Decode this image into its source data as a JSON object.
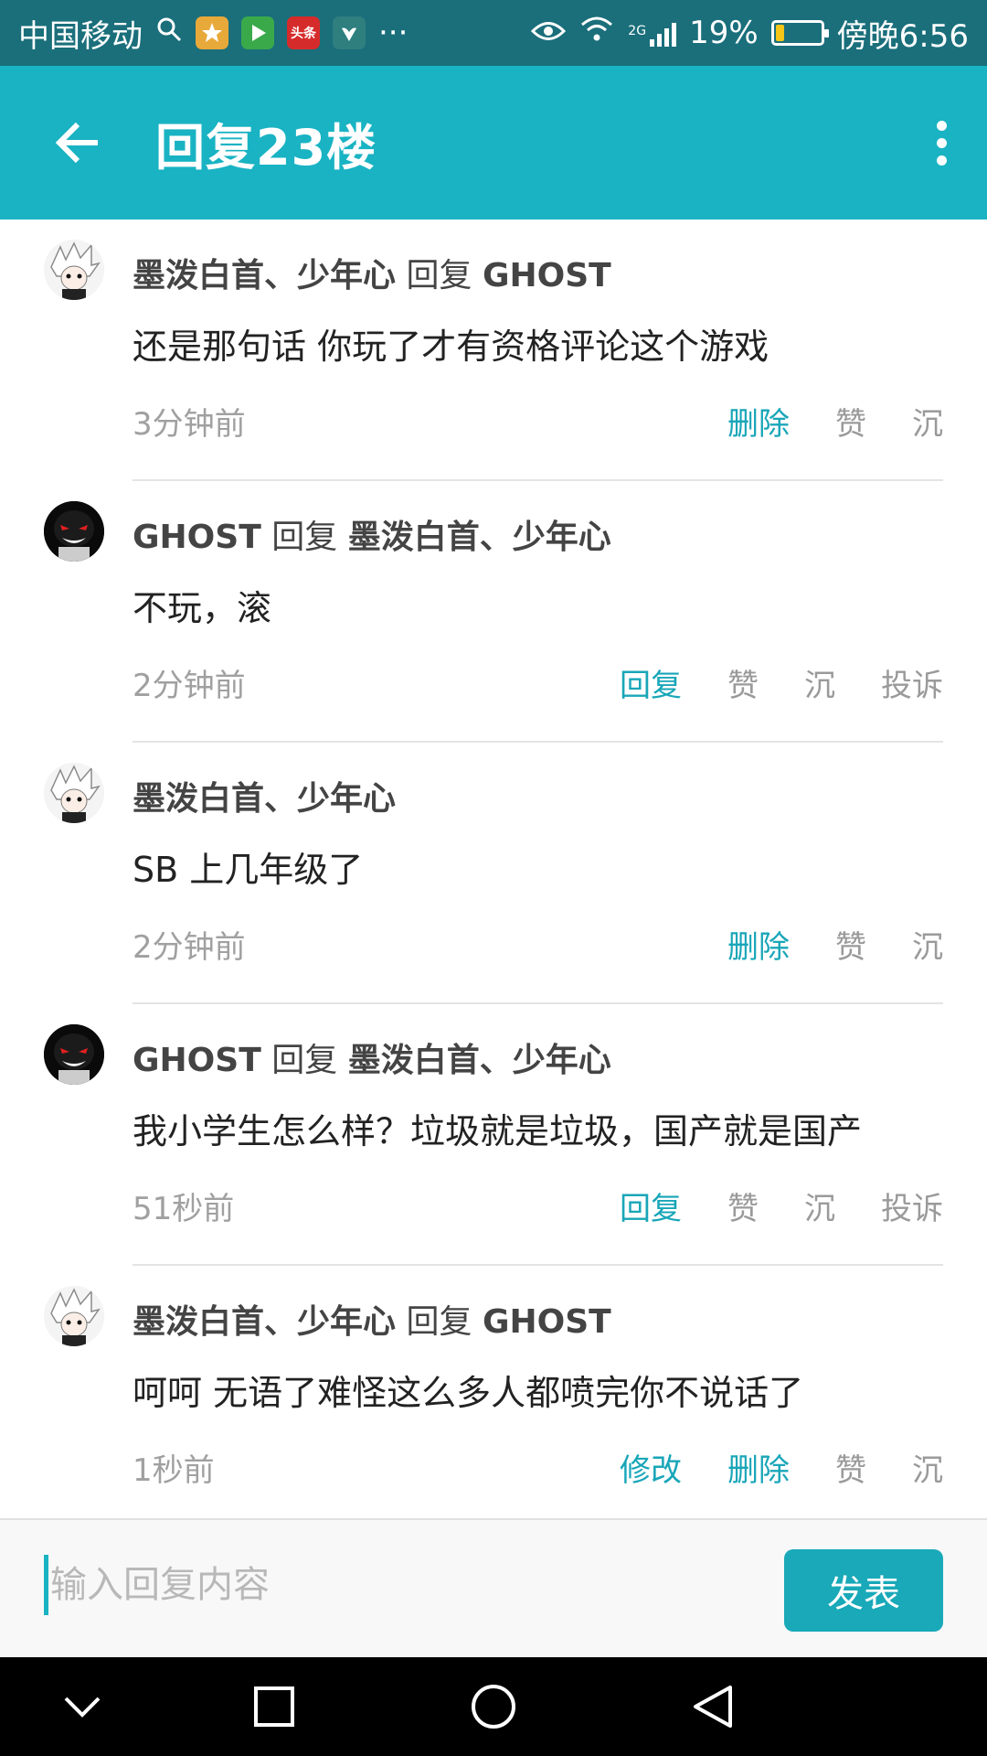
{
  "status_bar": {
    "carrier": "中国移动",
    "apps": [
      {
        "icon": "search-icon",
        "label": ""
      },
      {
        "icon": "star-app-icon",
        "label": "",
        "color": "#e8a93b"
      },
      {
        "icon": "play-store-icon",
        "label": "",
        "color": "#3aa94a"
      },
      {
        "icon": "toutiao-icon",
        "label": "头条",
        "color": "#d62b2b"
      },
      {
        "icon": "huawei-icon",
        "label": "",
        "color": "#2f7f7f"
      }
    ],
    "more": "···",
    "network": "2G",
    "battery": "19%",
    "battery_level": 0.19,
    "time": "傍晚6:56"
  },
  "header": {
    "title": "回复23楼",
    "back_icon": "arrow-left-icon",
    "more_icon": "more-vertical-icon"
  },
  "comments": [
    {
      "author": "墨泼白首、少年心",
      "reply_word": "回复",
      "reply_to": "GHOST",
      "avatar": "white",
      "text": "还是那句话 你玩了才有资格评论这个游戏",
      "time": "3分钟前",
      "actions": [
        {
          "label": "删除",
          "accent": true
        },
        {
          "label": "赞",
          "accent": false
        },
        {
          "label": "沉",
          "accent": false
        }
      ]
    },
    {
      "author": "GHOST",
      "reply_word": "回复",
      "reply_to": "墨泼白首、少年心",
      "avatar": "black",
      "text": "不玩，滚",
      "time": "2分钟前",
      "actions": [
        {
          "label": "回复",
          "accent": true
        },
        {
          "label": "赞",
          "accent": false
        },
        {
          "label": "沉",
          "accent": false
        },
        {
          "label": "投诉",
          "accent": false
        }
      ]
    },
    {
      "author": "墨泼白首、少年心",
      "reply_word": "",
      "reply_to": "",
      "avatar": "white",
      "text": "SB 上几年级了",
      "time": "2分钟前",
      "actions": [
        {
          "label": "删除",
          "accent": true
        },
        {
          "label": "赞",
          "accent": false
        },
        {
          "label": "沉",
          "accent": false
        }
      ]
    },
    {
      "author": "GHOST",
      "reply_word": "回复",
      "reply_to": "墨泼白首、少年心",
      "avatar": "black",
      "text": "我小学生怎么样？垃圾就是垃圾，国产就是国产",
      "time": "51秒前",
      "actions": [
        {
          "label": "回复",
          "accent": true
        },
        {
          "label": "赞",
          "accent": false
        },
        {
          "label": "沉",
          "accent": false
        },
        {
          "label": "投诉",
          "accent": false
        }
      ]
    },
    {
      "author": "墨泼白首、少年心",
      "reply_word": "回复",
      "reply_to": "GHOST",
      "avatar": "white",
      "text": "呵呵 无语了难怪这么多人都喷完你不说话了",
      "time": "1秒前",
      "actions": [
        {
          "label": "修改",
          "accent": true
        },
        {
          "label": "删除",
          "accent": true
        },
        {
          "label": "赞",
          "accent": false
        },
        {
          "label": "沉",
          "accent": false
        }
      ]
    }
  ],
  "reply": {
    "placeholder": "输入回复内容",
    "value": "",
    "submit_label": "发表"
  },
  "nav": {
    "back": "nav-back-icon",
    "home": "nav-home-icon",
    "recents": "nav-recents-icon",
    "down": "nav-down-icon"
  },
  "colors": {
    "status_bar": "#1a6f7b",
    "header": "#19b3c3",
    "accent": "#19a6b8",
    "muted": "#a0a0a0"
  }
}
